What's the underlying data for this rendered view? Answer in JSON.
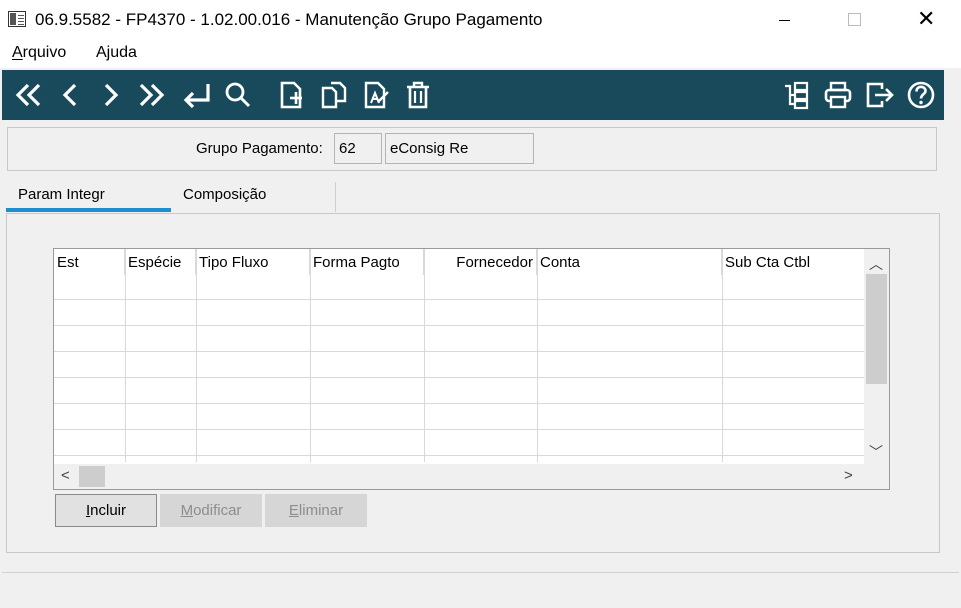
{
  "window": {
    "title": "06.9.5582 - FP4370 - 1.02.00.016 - Manutenção Grupo Pagamento",
    "minimize_icon": "minimize-icon",
    "maximize_icon": "maximize-icon",
    "close_icon": "close-icon",
    "close_glyph": "✕"
  },
  "menu": {
    "items": [
      {
        "label": "Arquivo",
        "mnemonic": "A"
      },
      {
        "label": "Ajuda",
        "mnemonic": "j"
      }
    ]
  },
  "toolbar": {
    "background": "#194a5c",
    "left_icons": [
      "first-record-icon",
      "previous-record-icon",
      "next-record-icon",
      "last-record-icon",
      "go-to-icon",
      "search-icon",
      "new-document-icon",
      "copy-document-icon",
      "edit-document-icon",
      "delete-icon"
    ],
    "right_icons": [
      "structure-icon",
      "print-icon",
      "exit-icon",
      "help-icon"
    ]
  },
  "header": {
    "grupo_pagamento_label": "Grupo Pagamento:",
    "grupo_pagamento_code": "62",
    "grupo_pagamento_desc": "eConsig Re"
  },
  "tabs": [
    {
      "label": "Param Integr",
      "active": true
    },
    {
      "label": "Composição",
      "active": false
    }
  ],
  "grid": {
    "columns": [
      {
        "label": "Est",
        "align": "left"
      },
      {
        "label": "Espécie",
        "align": "left"
      },
      {
        "label": "Tipo Fluxo",
        "align": "left"
      },
      {
        "label": "Forma Pagto",
        "align": "left"
      },
      {
        "label": "Fornecedor",
        "align": "right"
      },
      {
        "label": "Conta",
        "align": "left"
      },
      {
        "label": "Sub Cta Ctbl",
        "align": "left"
      }
    ],
    "rows": [
      [],
      [],
      [],
      [],
      [],
      [],
      []
    ]
  },
  "buttons": {
    "incluir": {
      "label": "Incluir",
      "enabled": true
    },
    "modificar": {
      "label": "Modificar",
      "enabled": false
    },
    "eliminar": {
      "label": "Eliminar",
      "enabled": false
    }
  },
  "colors": {
    "accent_tab": "#1d8fd1",
    "toolbar_bg": "#194a5c"
  }
}
